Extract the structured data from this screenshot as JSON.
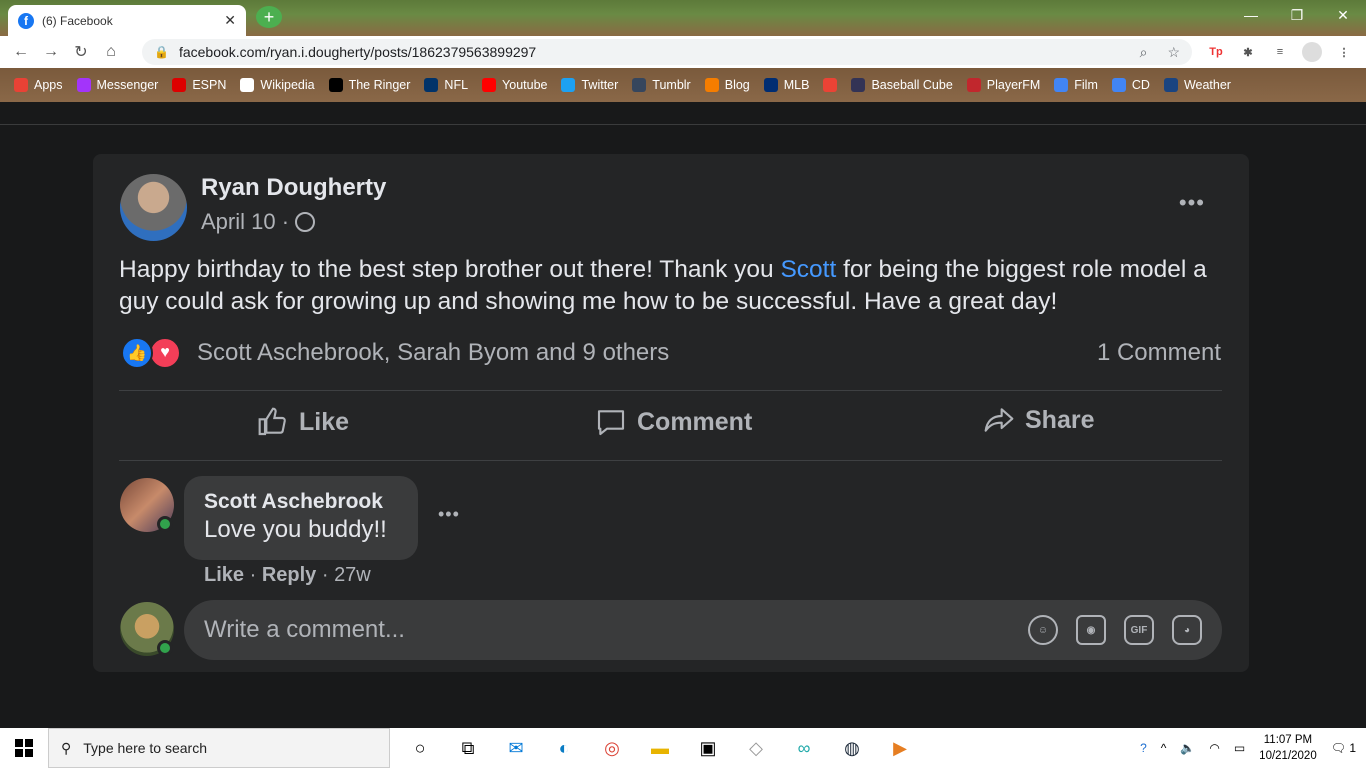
{
  "browser": {
    "tab_title": "(6) Facebook",
    "url": "facebook.com/ryan.i.dougherty/posts/1862379563899297",
    "bookmarks": [
      {
        "label": "Apps",
        "icon": "apps-grid-icon",
        "color": "#e94235"
      },
      {
        "label": "Messenger",
        "icon": "messenger-icon",
        "color": "#a334fa"
      },
      {
        "label": "ESPN",
        "icon": "espn-icon",
        "color": "#d00"
      },
      {
        "label": "Wikipedia",
        "icon": "wikipedia-icon",
        "color": "#fff"
      },
      {
        "label": "The Ringer",
        "icon": "ringer-icon",
        "color": "#000"
      },
      {
        "label": "NFL",
        "icon": "nfl-icon",
        "color": "#013369"
      },
      {
        "label": "Youtube",
        "icon": "youtube-icon",
        "color": "#f00"
      },
      {
        "label": "Twitter",
        "icon": "twitter-icon",
        "color": "#1da1f2"
      },
      {
        "label": "Tumblr",
        "icon": "tumblr-icon",
        "color": "#36465d"
      },
      {
        "label": "Blog",
        "icon": "blogger-icon",
        "color": "#f57d00"
      },
      {
        "label": "MLB",
        "icon": "mlb-icon",
        "color": "#002d72"
      },
      {
        "label": "",
        "icon": "gmail-icon",
        "color": "#ea4335"
      },
      {
        "label": "Baseball Cube",
        "icon": "baseball-cube-icon",
        "color": "#335"
      },
      {
        "label": "PlayerFM",
        "icon": "playerfm-icon",
        "color": "#c1272d"
      },
      {
        "label": "Film",
        "icon": "docs-icon",
        "color": "#4285f4"
      },
      {
        "label": "CD",
        "icon": "docs-icon",
        "color": "#4285f4"
      },
      {
        "label": "Weather",
        "icon": "weather-channel-icon",
        "color": "#1a4480"
      }
    ]
  },
  "post": {
    "author": "Ryan Dougherty",
    "date": "April 10 ·",
    "text_before": "Happy birthday to the best step brother out there! Thank you ",
    "mention": "Scott",
    "text_after": " for being the biggest role model a guy could ask for growing up and showing me how to be successful. Have a great day!",
    "reactions_text": "Scott Aschebrook, Sarah Byom and 9 others",
    "comment_count": "1 Comment",
    "actions": {
      "like": "Like",
      "comment": "Comment",
      "share": "Share"
    }
  },
  "comment": {
    "author": "Scott Aschebrook",
    "text": "Love you buddy!!",
    "like": "Like",
    "reply": "Reply",
    "age": "27w"
  },
  "composer": {
    "placeholder": "Write a comment...",
    "gif_label": "GIF"
  },
  "taskbar": {
    "search_placeholder": "Type here to search",
    "time": "11:07 PM",
    "date": "10/21/2020",
    "notification_count": "1"
  },
  "colors": {
    "facebook_blue": "#1877f2",
    "mention": "#4599ff",
    "love_red": "#f33e58",
    "online_green": "#31a24c"
  }
}
